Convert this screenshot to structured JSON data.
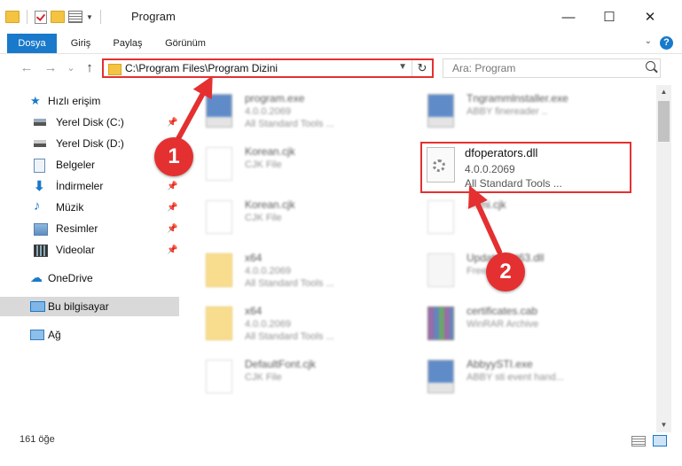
{
  "window": {
    "title": "Program",
    "minimize_icon": "—",
    "maximize_icon": "☐",
    "close_icon": "✕"
  },
  "ribbon": {
    "tabs": [
      {
        "label": "Dosya"
      },
      {
        "label": "Giriş"
      },
      {
        "label": "Paylaş"
      },
      {
        "label": "Görünüm"
      }
    ],
    "help_label": "?"
  },
  "navigation": {
    "back_icon": "←",
    "forward_icon": "→",
    "recent_icon": "⌄",
    "up_icon": "↑",
    "address_path": "C:\\Program Files\\Program Dizini",
    "refresh_icon": "↻",
    "search_placeholder": "Ara: Program"
  },
  "sidebar": {
    "items": [
      {
        "label": "Hızlı erişim",
        "icon": "star-icon"
      },
      {
        "label": "Yerel Disk (C:)",
        "icon": "drive-icon"
      },
      {
        "label": "Yerel Disk (D:)",
        "icon": "drive-icon"
      },
      {
        "label": "Belgeler",
        "icon": "documents-icon"
      },
      {
        "label": "İndirmeler",
        "icon": "download-icon"
      },
      {
        "label": "Müzik",
        "icon": "music-icon"
      },
      {
        "label": "Resimler",
        "icon": "pictures-icon"
      },
      {
        "label": "Videolar",
        "icon": "video-icon"
      },
      {
        "label": "OneDrive",
        "icon": "cloud-icon"
      },
      {
        "label": "Bu bilgisayar",
        "icon": "computer-icon"
      },
      {
        "label": "Ağ",
        "icon": "network-icon"
      }
    ]
  },
  "files": [
    {
      "name": "program.exe",
      "line2": "4.0.0.2069",
      "line3": "All Standard Tools ...",
      "icon": "exe-icon"
    },
    {
      "name": "Tngrammlnstaller.exe",
      "line2": "ABBY finereader ..",
      "line3": "",
      "icon": "exe-icon"
    },
    {
      "name": "Korean.cjk",
      "line2": "CJK File",
      "line3": "",
      "icon": "file-icon"
    },
    {
      "name": "Korean.cjk",
      "line2": "CJK File",
      "line3": "",
      "icon": "file-icon"
    },
    {
      "name": "...rmi.cjk",
      "line2": "",
      "line3": "",
      "icon": "file-icon"
    },
    {
      "name": "x64",
      "line2": "4.0.0.2069",
      "line3": "All Standard Tools ...",
      "icon": "folder-icon"
    },
    {
      "name": "Update...nt63.dll",
      "line2": "Free...",
      "line3": "",
      "icon": "dll-icon"
    },
    {
      "name": "x64",
      "line2": "4.0.0.2069",
      "line3": "All Standard Tools ...",
      "icon": "folder-icon"
    },
    {
      "name": "certificates.cab",
      "line2": "WinRAR Archive",
      "line3": "",
      "icon": "archive-icon"
    },
    {
      "name": "DefaultFont.cjk",
      "line2": "CJK File",
      "line3": "",
      "icon": "file-icon"
    },
    {
      "name": "AbbyySTI.exe",
      "line2": "ABBY sti event hand...",
      "line3": "",
      "icon": "exe-icon"
    }
  ],
  "highlighted_file": {
    "name": "dfoperators.dll",
    "version": "4.0.0.2069",
    "description": "All Standard Tools ..."
  },
  "markers": {
    "one": "1",
    "two": "2"
  },
  "status": {
    "count": "161 öğe"
  },
  "colors": {
    "accent": "#1979ca",
    "highlight": "#e43030"
  }
}
